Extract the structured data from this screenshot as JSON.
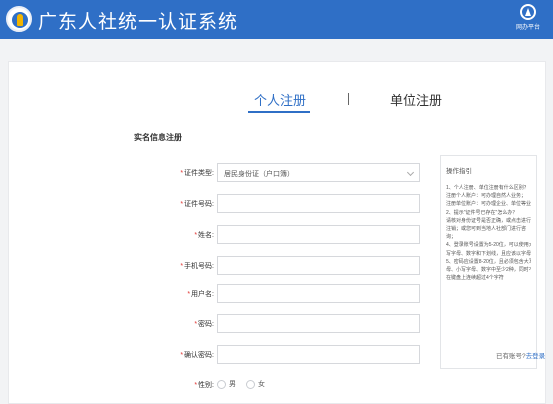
{
  "header": {
    "title": "广东人社统一认证系统",
    "portal_label": "网办平台",
    "logo_icon": "hrss-emblem-icon",
    "portal_icon": "portal-home-icon",
    "bg_color": "#2f6fc6"
  },
  "tabs": {
    "personal": "个人注册",
    "unit": "单位注册",
    "active": "personal"
  },
  "section": {
    "title": "实名信息注册"
  },
  "form": {
    "id_type": {
      "label": "证件类型:",
      "value": "居民身份证（户口簿）"
    },
    "id_number": {
      "label": "证件号码:",
      "value": ""
    },
    "name": {
      "label": "姓名:",
      "value": ""
    },
    "phone": {
      "label": "手机号码:",
      "value": ""
    },
    "username": {
      "label": "用户名:",
      "value": ""
    },
    "password": {
      "label": "密码:",
      "value": ""
    },
    "confirm_password": {
      "label": "确认密码:",
      "value": ""
    },
    "gender": {
      "label": "性别:",
      "options": [
        "男",
        "女"
      ]
    },
    "required_mark": "*"
  },
  "tips": {
    "title": "操作指引",
    "lines": [
      "1、个人注册、单位注册有什么区别？",
      "注册个人账户：可办理自然人业务；",
      "注册单位账户：可办理企业、单位等业务；",
      "2、提示\"证件号已存在\"怎么办？",
      "请核对身份证号是否正确，或点击进行找号",
      "注销；或您可到当地人社部门进行咨",
      "询；",
      "4、登录账号设置为5-20位，可以使用大小",
      "写字母、数字和下划线，且应该以字母开始",
      "5、密码应设置8-20位，且必须包含大写字",
      "母、小写字母、数字中至少2种，同时不能",
      "在键盘上连续超过4个字符"
    ]
  },
  "footer": {
    "have_account": "已有账号?",
    "login_link": "去登录"
  }
}
